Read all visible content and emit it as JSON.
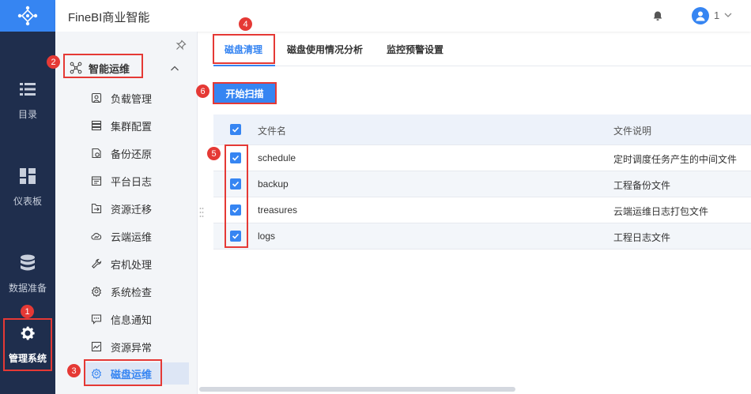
{
  "app": {
    "title": "FineBI商业智能"
  },
  "header": {
    "user_count": "1"
  },
  "rail": {
    "items": [
      {
        "label": "目录",
        "icon": "list-icon"
      },
      {
        "label": "仪表板",
        "icon": "dashboard-icon"
      },
      {
        "label": "数据准备",
        "icon": "database-icon"
      },
      {
        "label": "管理系统",
        "icon": "gear-icon"
      }
    ]
  },
  "sidebar": {
    "group": {
      "label": "智能运维"
    },
    "items": [
      {
        "label": "负载管理"
      },
      {
        "label": "集群配置"
      },
      {
        "label": "备份还原"
      },
      {
        "label": "平台日志"
      },
      {
        "label": "资源迁移"
      },
      {
        "label": "云端运维"
      },
      {
        "label": "宕机处理"
      },
      {
        "label": "系统检查"
      },
      {
        "label": "信息通知"
      },
      {
        "label": "资源异常"
      },
      {
        "label": "磁盘运维"
      }
    ]
  },
  "tabs": [
    {
      "label": "磁盘清理"
    },
    {
      "label": "磁盘使用情况分析"
    },
    {
      "label": "监控预警设置"
    }
  ],
  "toolbar": {
    "scan_label": "开始扫描"
  },
  "table": {
    "headers": {
      "name": "文件名",
      "desc": "文件说明"
    },
    "rows": [
      {
        "name": "schedule",
        "desc": "定时调度任务产生的中间文件"
      },
      {
        "name": "backup",
        "desc": "工程备份文件"
      },
      {
        "name": "treasures",
        "desc": "云端运维日志打包文件"
      },
      {
        "name": "logs",
        "desc": "工程日志文件"
      }
    ]
  },
  "annotations": [
    "1",
    "2",
    "3",
    "4",
    "5",
    "6"
  ],
  "colors": {
    "accent": "#3685f2",
    "rail": "#1f2e4d",
    "annotation": "#e53935"
  }
}
